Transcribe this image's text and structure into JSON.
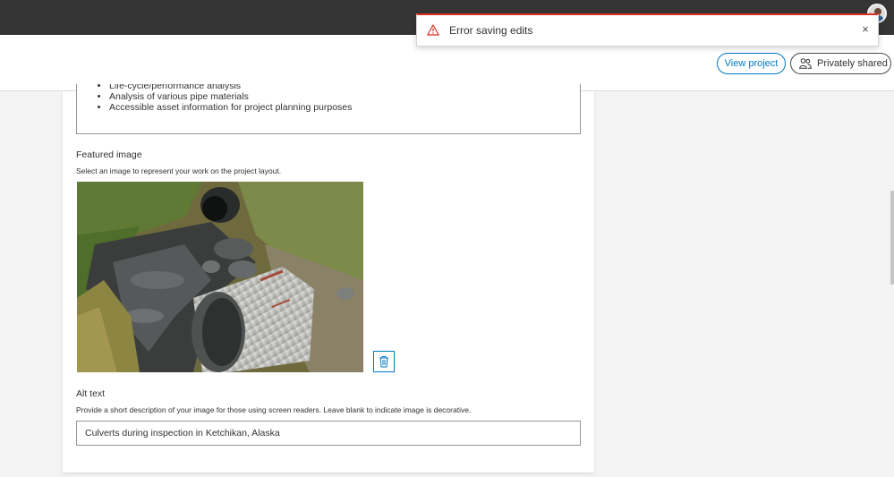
{
  "toast": {
    "message": "Error saving edits",
    "icon": "warning-triangle-icon",
    "close_glyph": "×",
    "accent": "#d83020"
  },
  "header": {
    "view_project_label": "View project",
    "sharing_label": "Privately shared",
    "sharing_icon": "people-icon",
    "accent": "#0079c1"
  },
  "content": {
    "description_bullets": [
      "Life-cycle/performance analysis",
      "Analysis of various pipe materials",
      "Accessible asset information for project planning purposes"
    ],
    "featured_image": {
      "label": "Featured image",
      "hint": "Select an image to represent your work on the project layout."
    },
    "alt_text": {
      "label": "Alt text",
      "hint": "Provide a short description of your image for those using screen readers. Leave blank to indicate image is decorative.",
      "value": "Culverts during inspection in Ketchikan, Alaska"
    }
  }
}
